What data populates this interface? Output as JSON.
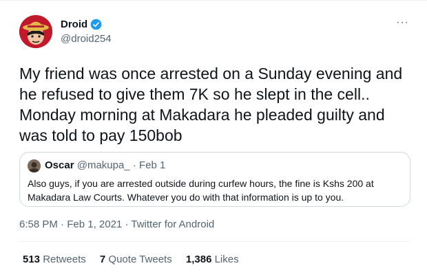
{
  "author": {
    "display_name": "Droid",
    "handle": "@droid254",
    "verified_icon": "verified-badge-icon"
  },
  "more_icon": "more-dots-icon",
  "more_glyph": "···",
  "tweet": {
    "lines": [
      "My friend was once arrested on a Sunday evening and",
      "he refused to give them 7K so he slept in the cell..",
      "Monday morning at Makadara he pleaded guilty and",
      "was told to pay 150bob"
    ]
  },
  "quoted": {
    "name": "Oscar",
    "handle": "@makupa_",
    "separator": "·",
    "date": "Feb 1",
    "lines": [
      "Also guys, if you are arrested outside during curfew hours, the fine is Kshs 200 at",
      "Makadara Law Courts. Whatever you do with that information is up to you."
    ]
  },
  "meta": {
    "time": "6:58 PM",
    "dot": "·",
    "date": "Feb 1, 2021",
    "source": "Twitter for Android"
  },
  "stats": {
    "retweets_count": "513",
    "retweets_label": "Retweets",
    "quotes_count": "7",
    "quotes_label": "Quote Tweets",
    "likes_count": "1,386",
    "likes_label": "Likes"
  },
  "colors": {
    "text": "#0f1419",
    "secondary": "#536471",
    "verified": "#1d9bf0",
    "border": "#cfd9de"
  }
}
